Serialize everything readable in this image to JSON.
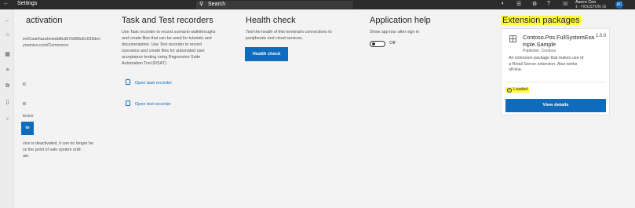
{
  "app": {
    "title": "Settings",
    "search_placeholder": "Search",
    "user_name": "Aaron Con",
    "user_store": "1 - HOUSTON-16",
    "avatar_initials": "AC"
  },
  "activation": {
    "title": "activation",
    "device_id_line1": "ev01sarfrazahmedd8cd67b986d2c635dev",
    "device_id_line2": "ynamics.com/Commerce",
    "value1": "l6",
    "value2": "l8",
    "device_label": "levice",
    "button_label": "te",
    "note_line1": "vice is deactivated, it can no longer be",
    "note_line2": "ss the point of sale system until",
    "note_line3": "ain."
  },
  "recorders": {
    "title": "Task and Test recorders",
    "description": [
      "Use Task recorder to record scenario walkthroughs",
      "and create files that can be used for tutorials and",
      "documentation. Use Test recorder to record",
      "scenarios and create files for automated user",
      "acceptance testing using Regression Suite",
      "Automation Tool (RSAT)."
    ],
    "task_link": "Open task recorder",
    "test_link": "Open test recorder"
  },
  "health": {
    "title": "Health check",
    "description": [
      "Test the health of this terminal's connections to",
      "peripherals and cloud services."
    ],
    "button_label": "Health check"
  },
  "app_help": {
    "title": "Application help",
    "label": "Show app tour after sign in",
    "toggle_state": "Off"
  },
  "extensions": {
    "title": "Extension packages",
    "name_line1": "Contoso.Pos.FullSystemExa",
    "name_line2": "mple.Sample",
    "version": "1.0.0",
    "publisher": "Publisher: Contoso",
    "description": [
      "An extension package that makes use of",
      "a Retail Server extension. Also works",
      "off-line."
    ],
    "status": "Loaded",
    "button_label": "View details",
    "highlight_color": "#fffb3a"
  },
  "colors": {
    "accent": "#0f6cbd",
    "topbar": "#2b2b2b",
    "background": "#f3f3f3"
  }
}
